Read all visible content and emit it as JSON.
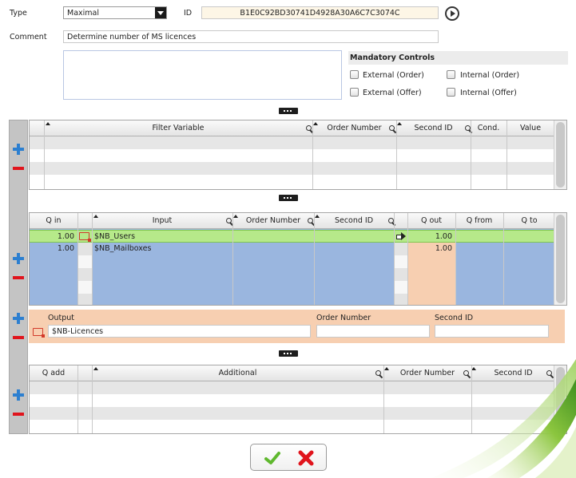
{
  "form": {
    "type_label": "Type",
    "type_value": "Maximal",
    "id_label": "ID",
    "id_value": "B1E0C92BD30741D4928A30A6C7C3074C",
    "comment_label": "Comment",
    "comment_value": "Determine number of MS licences",
    "mandatory_title": "Mandatory Controls",
    "checkboxes": [
      {
        "label": "External (Order)",
        "checked": false
      },
      {
        "label": "Internal (Order)",
        "checked": false
      },
      {
        "label": "External (Offer)",
        "checked": false
      },
      {
        "label": "Internal (Offer)",
        "checked": false
      }
    ]
  },
  "filter_grid": {
    "columns": [
      "Filter Variable",
      "Order Number",
      "Second ID",
      "Cond.",
      "Value"
    ],
    "rows": []
  },
  "input_grid": {
    "columns": [
      "Q in",
      "Input",
      "Order Number",
      "Second ID",
      "Q out",
      "Q from",
      "Q to"
    ],
    "rows": [
      {
        "q_in": "1.00",
        "input": "$NB_Users",
        "order_number": "",
        "second_id": "",
        "q_out": "1.00",
        "q_from": "",
        "q_to": "",
        "selected": true
      },
      {
        "q_in": "1.00",
        "input": "$NB_Mailboxes",
        "order_number": "",
        "second_id": "",
        "q_out": "1.00",
        "q_from": "",
        "q_to": "",
        "selected": false
      }
    ]
  },
  "output": {
    "output_label": "Output",
    "output_value": "$NB-Licences",
    "order_number_label": "Order Number",
    "order_number_value": "",
    "second_id_label": "Second ID",
    "second_id_value": ""
  },
  "additional_grid": {
    "columns": [
      "Q add",
      "Additional",
      "Order Number",
      "Second ID"
    ],
    "rows": []
  },
  "colors": {
    "selected_row": "#b6e98a",
    "row_blue": "#9ab6df",
    "q_out_col": "#f7cfb1",
    "add_icon": "#2c7fd0",
    "remove_icon": "#e0141c"
  }
}
